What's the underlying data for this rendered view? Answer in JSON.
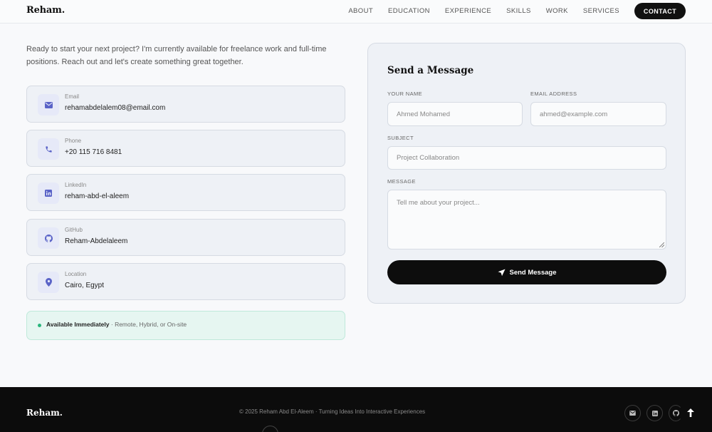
{
  "header": {
    "logo": "Reham.",
    "nav": [
      "ABOUT",
      "EDUCATION",
      "EXPERIENCE",
      "SKILLS",
      "WORK",
      "SERVICES"
    ],
    "cta": "CONTACT"
  },
  "intro": "Ready to start your next project? I'm currently available for freelance work and full-time positions. Reach out and let's create something great together.",
  "contacts": [
    {
      "label": "Email",
      "value": "rehamabdelalem08@email.com",
      "icon": "mail-icon"
    },
    {
      "label": "Phone",
      "value": "+20 115 716 8481",
      "icon": "phone-icon"
    },
    {
      "label": "LinkedIn",
      "value": "reham-abd-el-aleem",
      "icon": "linkedin-icon"
    },
    {
      "label": "GitHub",
      "value": "Reham-Abdelaleem",
      "icon": "github-icon"
    },
    {
      "label": "Location",
      "value": "Cairo, Egypt",
      "icon": "location-pin-icon"
    }
  ],
  "availability": {
    "status": "Available Immediately",
    "detail": " · Remote, Hybrid, or On-site"
  },
  "form": {
    "title": "Send a Message",
    "name_label": "YOUR NAME",
    "name_placeholder": "Ahmed Mohamed",
    "email_label": "EMAIL ADDRESS",
    "email_placeholder": "ahmed@example.com",
    "subject_label": "SUBJECT",
    "subject_placeholder": "Project Collaboration",
    "message_label": "MESSAGE",
    "message_placeholder": "Tell me about your project...",
    "submit_label": "Send Message"
  },
  "footer": {
    "logo": "Reham.",
    "copyright": "© 2025 Reham Abd El-Aleem · Turning Ideas Into Interactive Experiences"
  },
  "colors": {
    "accent": "#5a63c7",
    "available_dot": "#2ab67d",
    "footer_bg": "#0c0c0c"
  }
}
